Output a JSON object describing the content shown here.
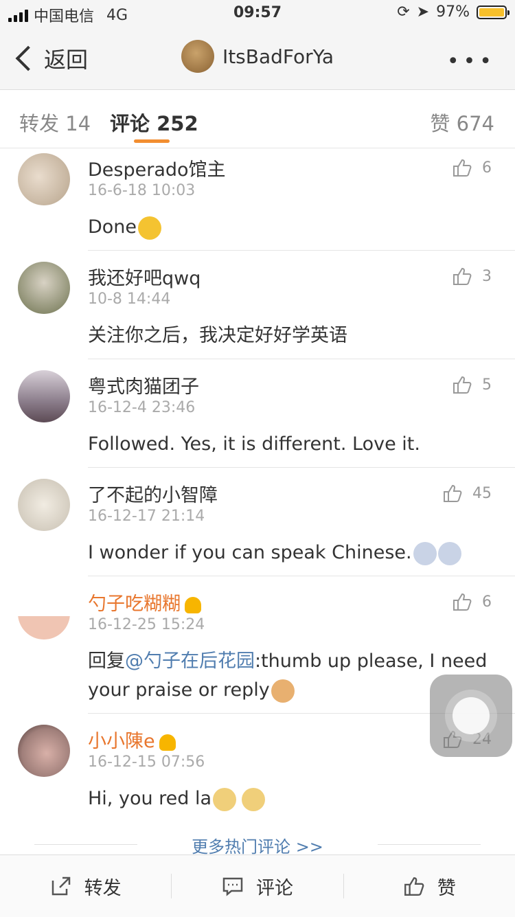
{
  "status_bar": {
    "carrier": "中国电信",
    "network": "4G",
    "time": "09:57",
    "battery": "97%"
  },
  "nav": {
    "back_label": "返回",
    "title": "ItsBadForYa",
    "more": "•••"
  },
  "tabs": {
    "repost": "转发 14",
    "comments": "评论 252",
    "likes": "赞 674"
  },
  "comments": [
    {
      "name": "Desperado馆主",
      "time": "16-6-18 10:03",
      "text": "Done",
      "likes": "6",
      "avatar_color": "#b7a48c"
    },
    {
      "name": "我还好吧qwq",
      "time": "10-8 14:44",
      "text": "关注你之后，我决定好好学英语",
      "likes": "3",
      "avatar_color": "#6e7350"
    },
    {
      "name": "粤式肉猫团子",
      "time": "16-12-4 23:46",
      "text": "Followed. Yes, it is different. Love it.",
      "likes": "5",
      "avatar_color": "#8b7d8b"
    },
    {
      "name": "了不起的小智障",
      "time": "16-12-17 21:14",
      "text": "I wonder if you can speak Chinese.",
      "likes": "45",
      "avatar_color": "#c8c0b2"
    },
    {
      "name": "勺子吃糊糊",
      "time": "16-12-25 15:24",
      "reply_prefix": "回复",
      "mention": "@勺子在后花园",
      "text": ":thumb up please, I need your praise or reply",
      "likes": "6",
      "avatar_color": "#f3d7c9"
    },
    {
      "name": "小小陳e",
      "time": "16-12-15 07:56",
      "text": "Hi,  you red la",
      "likes": "24",
      "avatar_color": "#a07f7a"
    }
  ],
  "more_hot": "更多热门评论 >>",
  "bottom_bar": {
    "repost": "转发",
    "comment": "评论",
    "like": "赞"
  },
  "colors": {
    "accent": "#f28e30",
    "link": "#507daf",
    "vip_name": "#e8762d"
  }
}
